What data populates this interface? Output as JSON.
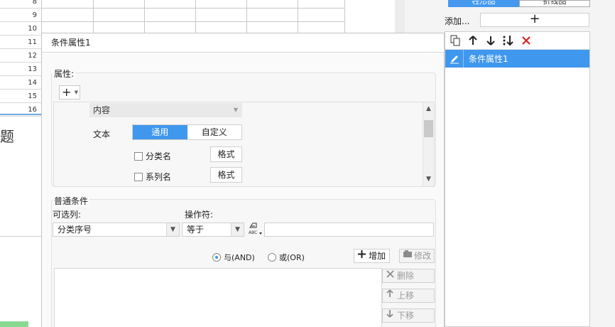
{
  "sheet": {
    "row_numbers": [
      "8",
      "9",
      "10",
      "11",
      "12",
      "13",
      "14",
      "15",
      "16"
    ],
    "title_fragment": "题"
  },
  "right_panel": {
    "chart_tabs": [
      {
        "label": "柱形图",
        "active": true
      },
      {
        "label": "折线图",
        "active": false
      }
    ],
    "add_label": "添加...",
    "add_button_symbol": "+",
    "toolbar_icons": [
      "copy-icon",
      "arrow-up-icon",
      "arrow-down-icon",
      "move-bottom-icon",
      "delete-icon"
    ],
    "items": [
      {
        "label": "条件属性1",
        "selected": true
      }
    ]
  },
  "dialog": {
    "title": "条件属性1",
    "attributes": {
      "label": "属性:",
      "content_dropdown": "内容",
      "text_label": "文本",
      "segment": {
        "options": [
          "通用",
          "自定义"
        ],
        "selected": "通用"
      },
      "checkboxes": [
        {
          "label": "分类名",
          "checked": false,
          "format_label": "格式"
        },
        {
          "label": "系列名",
          "checked": false,
          "format_label": "格式"
        }
      ]
    },
    "conditions": {
      "label": "普通条件",
      "column_label": "可选列:",
      "column_value": "分类序号",
      "operator_label": "操作符:",
      "operator_value": "等于",
      "value": "",
      "logic": {
        "and_label": "与(AND)",
        "or_label": "或(OR)",
        "selected": "and"
      },
      "buttons": {
        "add": "增加",
        "modify": "修改",
        "delete": "删除",
        "move_up": "上移",
        "move_down": "下移"
      }
    }
  },
  "colors": {
    "accent_blue": "#3f97ee",
    "delete_red": "#e02020",
    "sheet_green": "#89d991"
  }
}
